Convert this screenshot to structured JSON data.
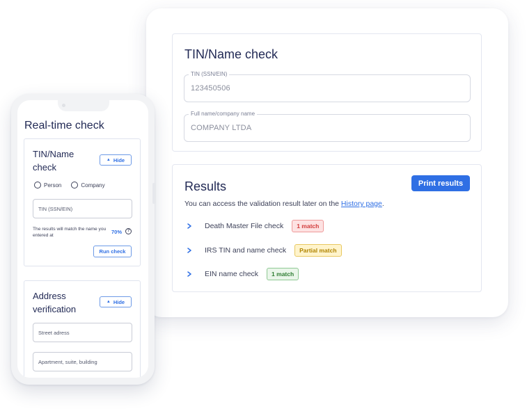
{
  "desktop": {
    "tin_panel": {
      "title": "TIN/Name check",
      "tin_field": {
        "legend": "TIN (SSN/EIN)",
        "value": "123450506"
      },
      "name_field": {
        "legend": "Full name/company name",
        "value": "COMPANY LTDA"
      }
    },
    "results_panel": {
      "title": "Results",
      "print_button": "Print results",
      "note_prefix": "You can access the validation result later on the ",
      "note_link": "History page",
      "note_suffix": ".",
      "rows": [
        {
          "label": "Death Master File check",
          "badge": "1 match",
          "status": "red"
        },
        {
          "label": "IRS TIN and name check",
          "badge": "Partial match",
          "status": "yellow"
        },
        {
          "label": "EIN name check",
          "badge": "1 match",
          "status": "green"
        }
      ]
    }
  },
  "phone": {
    "title": "Real-time check",
    "tin_card": {
      "title": "TIN/Name check",
      "hide_label": "Hide",
      "radio_person": "Person",
      "radio_company": "Company",
      "tin_placeholder": "TIN (SSN/EIN)",
      "match_note": "The results will match the name you entered at",
      "match_percent": "70%",
      "help_icon": "?",
      "run_button": "Run check"
    },
    "address_card": {
      "title": "Address verification",
      "hide_label": "Hide",
      "street_placeholder": "Street adress",
      "apartment_placeholder": "Apartment, suite, building"
    }
  },
  "colors": {
    "accent": "#2f6fe4",
    "title_text": "#222a55",
    "badge_red": "#d23c3c",
    "badge_yellow": "#b08400",
    "badge_green": "#2e7d32"
  },
  "icons": {
    "row_expand": "chevron-right-icon",
    "hide_caret": "chevron-up-icon",
    "help": "question-circle-icon"
  }
}
